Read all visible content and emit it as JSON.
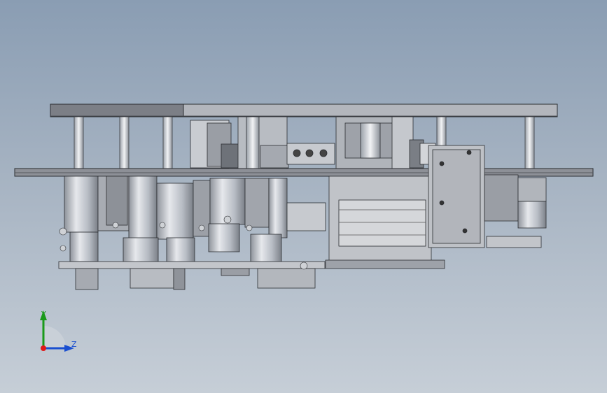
{
  "viewport": {
    "background_top": "#8a9db3",
    "background_bottom": "#c6ced7",
    "model": "cad-assembly-side-view"
  },
  "triad": {
    "y_label": "Y",
    "z_label": "Z",
    "x_color": "#e01818",
    "y_color": "#1a9a1a",
    "z_color": "#1a4fd0"
  }
}
